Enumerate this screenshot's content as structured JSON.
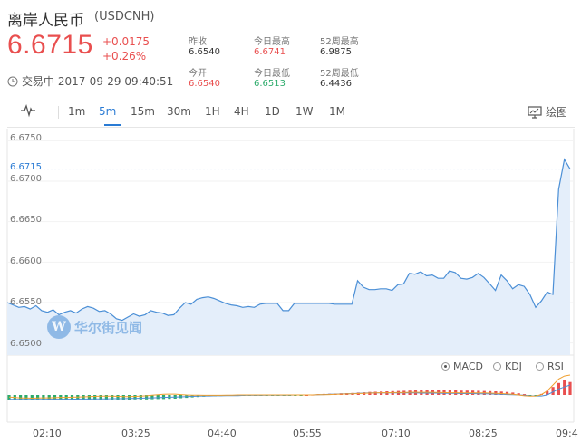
{
  "header": {
    "title": "离岸人民币",
    "code": "(USDCNH)",
    "price": "6.6715",
    "change": "+0.0175",
    "change_pct": "+0.26%",
    "status": "交易中 2017-09-29 09:40:51"
  },
  "stats": [
    {
      "label": "昨收",
      "value": "6.6540",
      "color": "#333333"
    },
    {
      "label": "今日最高",
      "value": "6.6741",
      "color": "#e94f4f"
    },
    {
      "label": "52周最高",
      "value": "6.9875",
      "color": "#333333"
    },
    {
      "label": "今开",
      "value": "6.6540",
      "color": "#e94f4f"
    },
    {
      "label": "今日最低",
      "value": "6.6513",
      "color": "#2cab6b"
    },
    {
      "label": "52周最低",
      "value": "6.4436",
      "color": "#333333"
    }
  ],
  "toolbar": {
    "intervals": [
      "1m",
      "5m",
      "15m",
      "30m",
      "1H",
      "4H",
      "1D",
      "1W",
      "1M"
    ],
    "active": "5m",
    "draw_label": "绘图"
  },
  "indicators": {
    "options": [
      "MACD",
      "KDJ",
      "RSI"
    ],
    "selected": "MACD"
  },
  "watermark": {
    "logo": "W",
    "text": "华尔街见闻"
  },
  "colors": {
    "up": "#e94f4f",
    "down": "#2cab6b",
    "line": "#4b8fd6",
    "accent": "#2a7bd4"
  },
  "chart_data": {
    "type": "area",
    "y_ticks": [
      "6.6750",
      "6.6700",
      "6.6650",
      "6.6600",
      "6.6550",
      "6.6500"
    ],
    "current_label": "6.6715",
    "x_ticks": [
      "02:10",
      "03:25",
      "04:40",
      "05:55",
      "07:10",
      "08:25",
      "09:4"
    ],
    "ylim": [
      6.6485,
      6.6765
    ],
    "series": [
      {
        "values": [
          6.655,
          6.6547,
          6.6544,
          6.6545,
          6.6542,
          6.6546,
          6.654,
          6.6538,
          6.6541,
          6.6535,
          6.6538,
          6.654,
          6.6537,
          6.6542,
          6.6545,
          6.6543,
          6.6539,
          6.654,
          6.6536,
          6.653,
          6.6528,
          6.6532,
          6.6536,
          6.6533,
          6.6535,
          6.654,
          6.6538,
          6.6537,
          6.6534,
          6.6535,
          6.6543,
          6.655,
          6.6548,
          6.6554,
          6.6556,
          6.6557,
          6.6555,
          6.6552,
          6.6549,
          6.6547,
          6.6546,
          6.6544,
          6.6545,
          6.6544,
          6.6548,
          6.6549,
          6.6549,
          6.6549,
          6.654,
          6.654,
          6.6549,
          6.6549,
          6.6549,
          6.6549,
          6.6549,
          6.6549,
          6.6549,
          6.6548,
          6.6548,
          6.6548,
          6.6548,
          6.6577,
          6.6569,
          6.6566,
          6.6566,
          6.6567,
          6.6567,
          6.6565,
          6.6572,
          6.6573,
          6.6586,
          6.6585,
          6.6588,
          6.6583,
          6.6584,
          6.658,
          6.658,
          6.6589,
          6.6587,
          6.658,
          6.6579,
          6.6581,
          6.6586,
          6.6581,
          6.6573,
          6.6565,
          6.6584,
          6.6577,
          6.6567,
          6.6572,
          6.657,
          6.656,
          6.6544,
          6.6552,
          6.6563,
          6.656,
          6.669,
          6.6727,
          6.6715
        ]
      }
    ],
    "macd": {
      "hist": [
        -0.25,
        -0.25,
        -0.26,
        -0.25,
        -0.26,
        -0.26,
        -0.27,
        -0.26,
        -0.27,
        -0.26,
        -0.26,
        -0.25,
        -0.25,
        -0.25,
        -0.26,
        -0.26,
        -0.25,
        -0.25,
        -0.24,
        -0.24,
        -0.24,
        -0.23,
        -0.22,
        -0.22,
        -0.22,
        -0.21,
        -0.2,
        -0.2,
        -0.19,
        -0.18,
        -0.16,
        -0.14,
        -0.12,
        -0.1,
        -0.08,
        -0.07,
        -0.06,
        -0.05,
        -0.04,
        -0.04,
        -0.04,
        -0.04,
        -0.03,
        -0.03,
        -0.02,
        -0.02,
        -0.02,
        -0.02,
        -0.02,
        -0.02,
        -0.01,
        -0.01,
        0,
        0.02,
        0.04,
        0.05,
        0.06,
        0.07,
        0.08,
        0.09,
        0.1,
        0.12,
        0.13,
        0.15,
        0.16,
        0.17,
        0.18,
        0.19,
        0.2,
        0.21,
        0.22,
        0.23,
        0.24,
        0.24,
        0.25,
        0.24,
        0.24,
        0.23,
        0.23,
        0.22,
        0.22,
        0.22,
        0.21,
        0.2,
        0.19,
        0.18,
        0.17,
        0.15,
        0.12,
        0.08,
        0.04,
        -0.02,
        -0.05,
        0.05,
        0.2,
        0.4,
        0.6,
        0.75,
        0.65
      ],
      "dif": [
        -0.1,
        -0.12,
        -0.15,
        -0.15,
        -0.16,
        -0.15,
        -0.14,
        -0.14,
        -0.13,
        -0.12,
        -0.12,
        -0.11,
        -0.1,
        -0.09,
        -0.08,
        -0.07,
        -0.06,
        -0.06,
        -0.06,
        -0.07,
        -0.08,
        -0.08,
        -0.07,
        -0.06,
        -0.04,
        -0.01,
        0.01,
        0.03,
        0.04,
        0.04,
        0.02,
        0,
        -0.01,
        -0.01,
        -0.02,
        -0.02,
        -0.02,
        -0.02,
        -0.01,
        -0.01,
        0,
        0,
        0,
        0,
        0,
        0,
        0,
        0,
        0,
        0,
        0,
        0,
        0,
        0,
        0.01,
        0.01,
        0.02,
        0.03,
        0.04,
        0.05,
        0.06,
        0.07,
        0.08,
        0.09,
        0.1,
        0.11,
        0.11,
        0.12,
        0.12,
        0.12,
        0.13,
        0.13,
        0.13,
        0.13,
        0.13,
        0.12,
        0.12,
        0.11,
        0.11,
        0.1,
        0.1,
        0.1,
        0.1,
        0.1,
        0.09,
        0.08,
        0.07,
        0.05,
        0.03,
        0,
        -0.04,
        -0.06,
        -0.05,
        0.02,
        0.2,
        0.5,
        0.8,
        0.95,
        1.0
      ],
      "dea": [
        -0.22,
        -0.22,
        -0.22,
        -0.22,
        -0.22,
        -0.22,
        -0.22,
        -0.21,
        -0.21,
        -0.21,
        -0.21,
        -0.21,
        -0.2,
        -0.2,
        -0.2,
        -0.19,
        -0.19,
        -0.19,
        -0.18,
        -0.18,
        -0.18,
        -0.17,
        -0.17,
        -0.16,
        -0.15,
        -0.14,
        -0.13,
        -0.12,
        -0.11,
        -0.1,
        -0.09,
        -0.08,
        -0.07,
        -0.06,
        -0.05,
        -0.05,
        -0.04,
        -0.04,
        -0.03,
        -0.03,
        -0.03,
        -0.02,
        -0.02,
        -0.02,
        -0.02,
        -0.01,
        -0.01,
        -0.01,
        -0.01,
        -0.01,
        0,
        0,
        0,
        0,
        0.01,
        0.02,
        0.03,
        0.04,
        0.05,
        0.06,
        0.07,
        0.08,
        0.09,
        0.1,
        0.1,
        0.1,
        0.1,
        0.1,
        0.1,
        0.1,
        0.1,
        0.1,
        0.09,
        0.09,
        0.09,
        0.09,
        0.08,
        0.08,
        0.08,
        0.07,
        0.07,
        0.07,
        0.06,
        0.06,
        0.05,
        0.04,
        0.03,
        0.02,
        0.01,
        0,
        -0.02,
        -0.04,
        -0.05,
        -0.05,
        0.0,
        0.15,
        0.3,
        0.4,
        0.5
      ]
    }
  }
}
